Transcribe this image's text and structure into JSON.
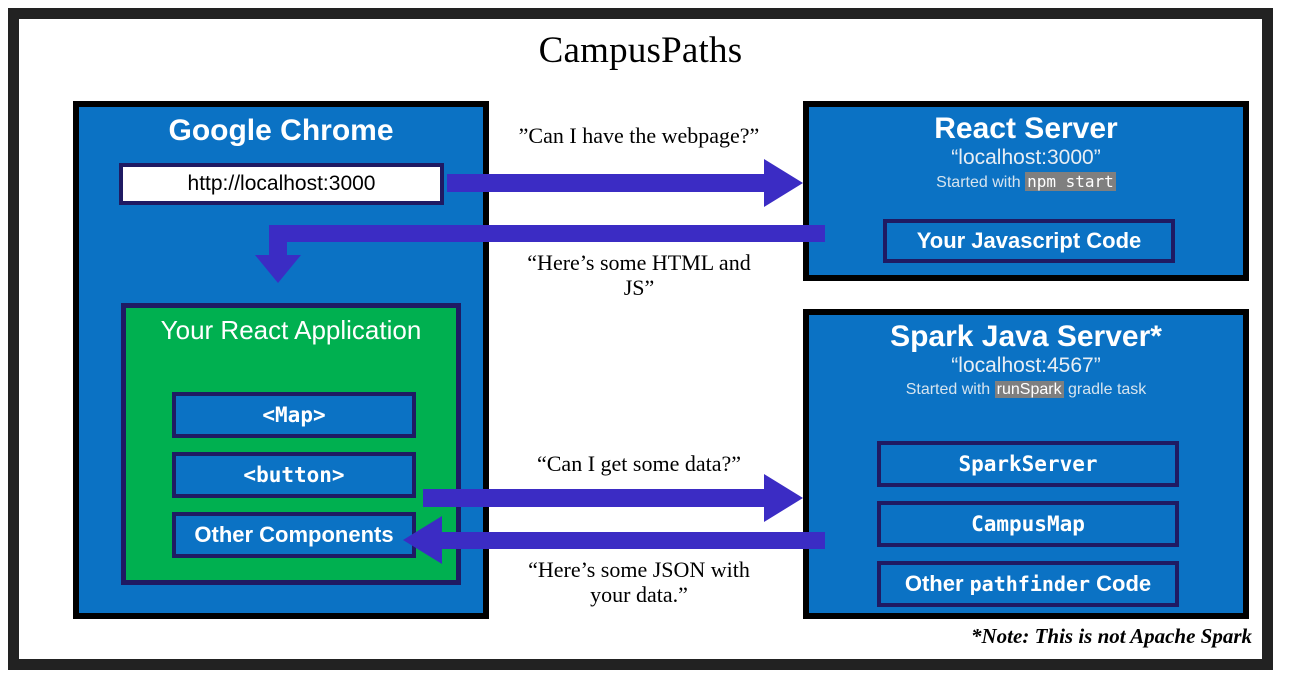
{
  "title": "CampusPaths",
  "colors": {
    "frame": "#222222",
    "box_blue": "#0b72c4",
    "box_green": "#00b050",
    "inner_border_navy": "#1f1a63",
    "arrow_purple": "#3b2cc4",
    "code_chip_gray": "#7f7f7f"
  },
  "chrome": {
    "title": "Google Chrome",
    "url_bar_value": "http://localhost:3000",
    "react_app": {
      "title": "Your React Application",
      "components": [
        {
          "label": "<Map>",
          "mono": true
        },
        {
          "label": "<button>",
          "mono": true
        },
        {
          "label": "Other Components",
          "mono": false
        }
      ]
    }
  },
  "react_server": {
    "title": "React Server",
    "host": "“localhost:3000”",
    "started_prefix": "Started with",
    "started_code": "npm start",
    "started_suffix": "",
    "boxes": [
      {
        "label": "Your Javascript Code",
        "mono": false
      }
    ]
  },
  "spark_server": {
    "title": "Spark Java Server*",
    "host": "“localhost:4567”",
    "started_prefix": "Started with",
    "started_code": "runSpark",
    "started_suffix": "gradle task",
    "boxes": [
      {
        "label": "SparkServer",
        "mono": true
      },
      {
        "label": "CampusMap",
        "mono": true
      },
      {
        "label_pre": "Other ",
        "label_mono": "pathfinder",
        "label_post": " Code",
        "mono": "mixed"
      }
    ]
  },
  "arrows": {
    "request_page": "”Can I have the webpage?”",
    "response_page_line1": "“Here’s some HTML and",
    "response_page_line2": "JS”",
    "request_data": "“Can I get some data?”",
    "response_data_line1": "“Here’s some JSON with",
    "response_data_line2": "your data.”"
  },
  "footnote": "*Note: This is not Apache Spark"
}
